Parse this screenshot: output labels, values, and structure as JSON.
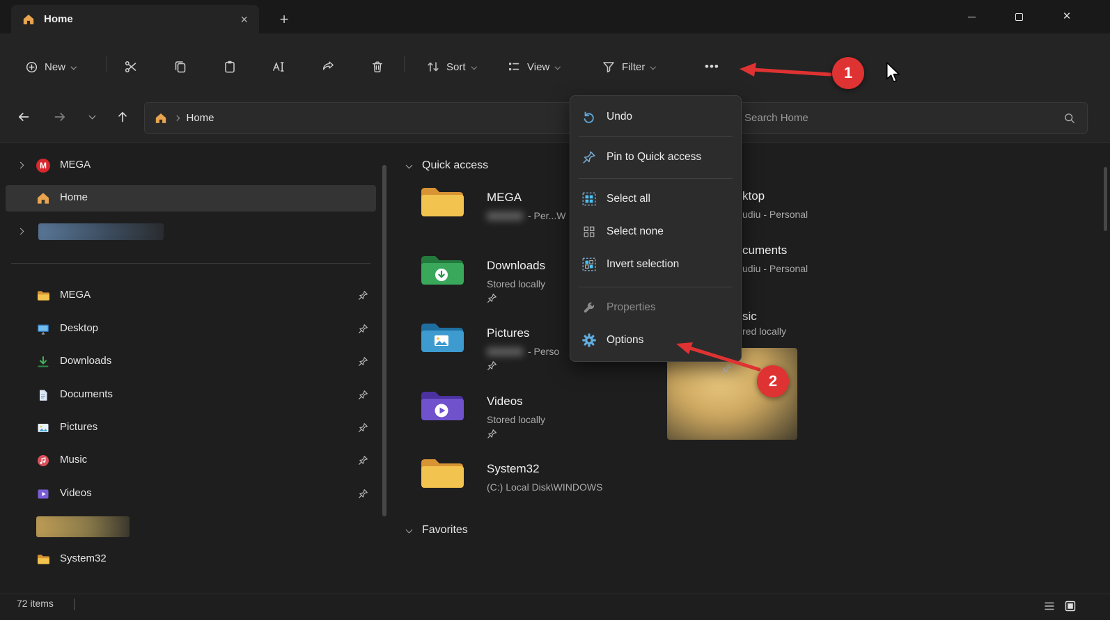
{
  "colors": {
    "accent_blue": "#4cc2ff",
    "annotation_red": "#df3232",
    "folder_yellow": "#f3c34f",
    "mega_red": "#d9272e",
    "selected_row": "#343434"
  },
  "icons": {
    "close": "×",
    "tab_close": "×",
    "new_tab": "+",
    "more": "•••"
  },
  "window": {
    "tab_title": "Home"
  },
  "toolbar": {
    "new": "New",
    "sort": "Sort",
    "view": "View",
    "filter": "Filter"
  },
  "navbar": {
    "breadcrumb": "Home",
    "search_placeholder": "Search Home"
  },
  "sidebar": {
    "items": [
      {
        "label": "MEGA"
      },
      {
        "label": "Home"
      },
      {
        "label": "MEGA"
      },
      {
        "label": "Desktop"
      },
      {
        "label": "Downloads"
      },
      {
        "label": "Documents"
      },
      {
        "label": "Pictures"
      },
      {
        "label": "Music"
      },
      {
        "label": "Videos"
      },
      {
        "label": "System32"
      }
    ]
  },
  "content": {
    "quick_access": "Quick access",
    "favorites": "Favorites",
    "tiles": [
      {
        "name": "MEGA",
        "subtitle_fragment": "- Per...W"
      },
      {
        "name": "Downloads",
        "subtitle": "Stored locally"
      },
      {
        "name": "Pictures",
        "subtitle_fragment": "- Perso"
      },
      {
        "name": "Videos",
        "subtitle": "Stored locally"
      },
      {
        "name": "System32",
        "subtitle": "(C:) Local Disk\\WINDOWS"
      }
    ],
    "right_fragments": [
      {
        "name": "ktop",
        "subtitle": "udiu - Personal"
      },
      {
        "name": "cuments",
        "subtitle": "udiu - Personal"
      },
      {
        "name": "sic",
        "subtitle": "red locally"
      }
    ]
  },
  "menu": {
    "items": [
      {
        "label": "Undo"
      },
      {
        "label": "Pin to Quick access"
      },
      {
        "label": "Select all"
      },
      {
        "label": "Select none"
      },
      {
        "label": "Invert selection"
      },
      {
        "label": "Properties",
        "disabled": true
      },
      {
        "label": "Options"
      }
    ]
  },
  "statusbar": {
    "count": "72 items"
  },
  "annotations": {
    "step1": "1",
    "step2": "2"
  }
}
